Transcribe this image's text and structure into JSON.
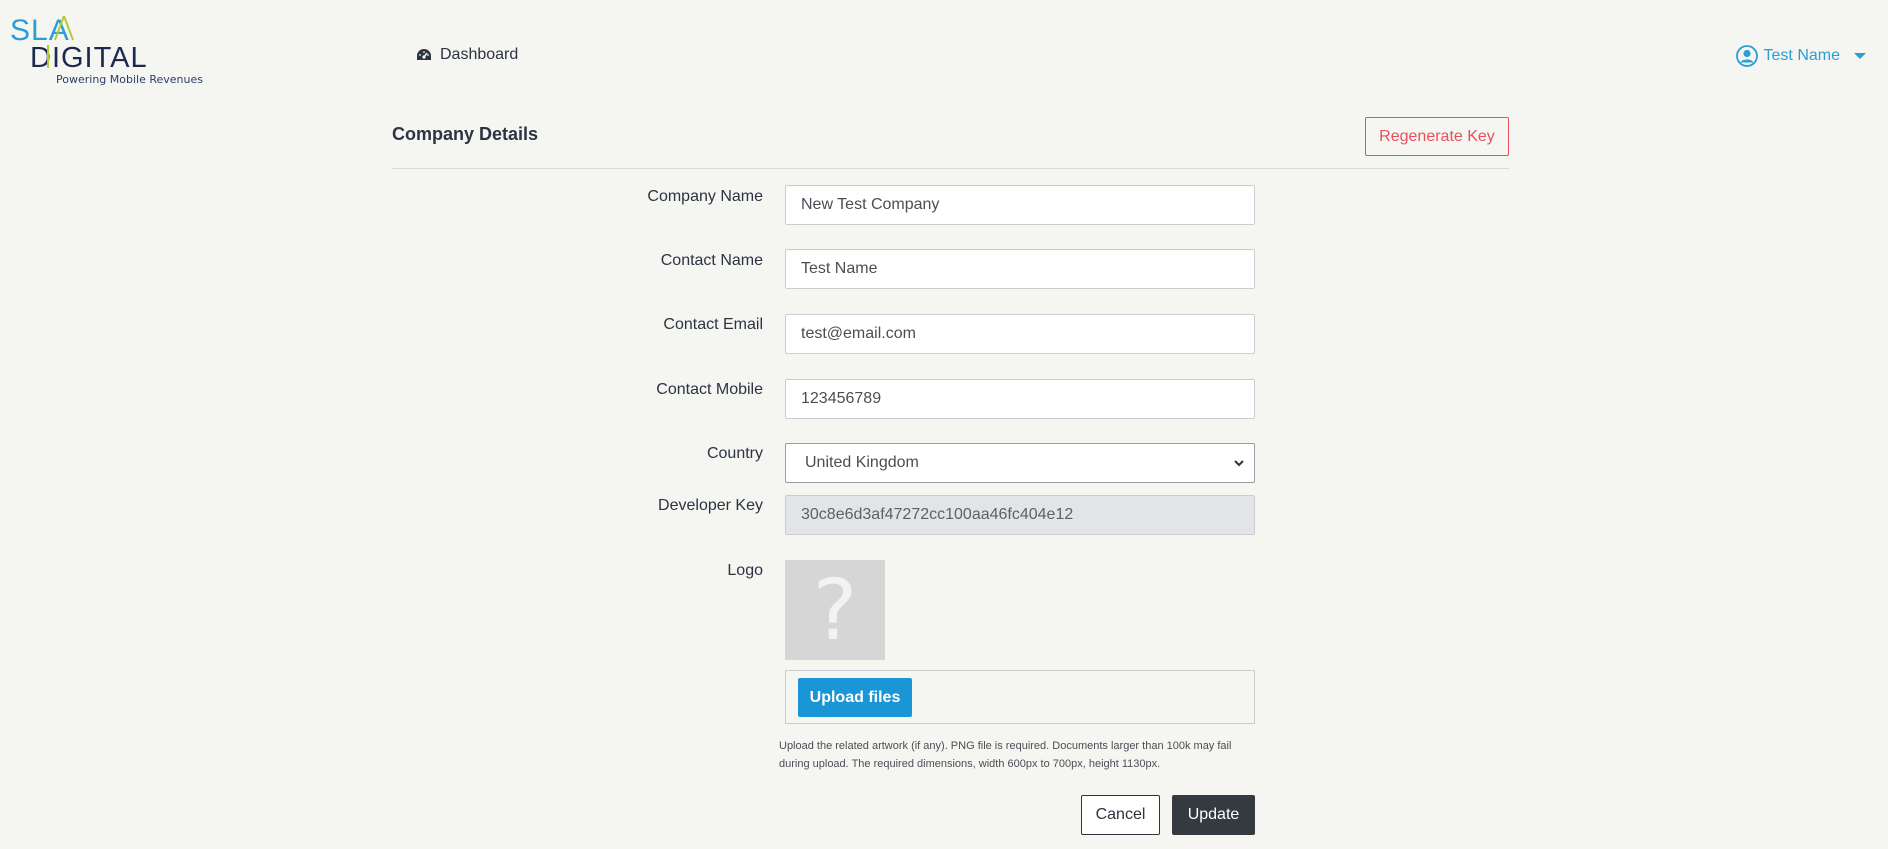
{
  "brand": {
    "logo_top": "SLA",
    "logo_bottom": "DIGITAL",
    "tagline": "Powering Mobile Revenues",
    "colors": {
      "blue": "#2a9fd6",
      "lime": "#b5c934",
      "navy": "#1d2a4d"
    }
  },
  "nav": {
    "dashboard_icon": "dashboard-gauge-icon",
    "dashboard_label": "Dashboard"
  },
  "user": {
    "icon": "user-circle-icon",
    "name": "Test Name"
  },
  "section": {
    "title": "Company Details",
    "regenerate_label": "Regenerate Key"
  },
  "form": {
    "company_name": {
      "label": "Company Name",
      "value": "New Test Company"
    },
    "contact_name": {
      "label": "Contact Name",
      "value": "Test Name"
    },
    "contact_email": {
      "label": "Contact Email",
      "value": "test@email.com"
    },
    "contact_mobile": {
      "label": "Contact Mobile",
      "value": "123456789"
    },
    "country": {
      "label": "Country",
      "value": "United Kingdom"
    },
    "developer_key": {
      "label": "Developer Key",
      "value": "30c8e6d3af47272cc100aa46fc404e12"
    },
    "logo": {
      "label": "Logo",
      "placeholder_glyph": "?",
      "upload_label": "Upload files",
      "help_line1": "Upload the related artwork (if any). PNG file is required. Documents larger than 100k may fail",
      "help_line2": "during upload. The required dimensions, width 600px to 700px, height 1130px."
    }
  },
  "actions": {
    "cancel_label": "Cancel",
    "update_label": "Update"
  },
  "colors": {
    "accent": "#2a9fd6",
    "danger": "#e8505b",
    "upload_button": "#1a95d6",
    "update_button": "#343a40",
    "background": "#f5f5f2"
  }
}
